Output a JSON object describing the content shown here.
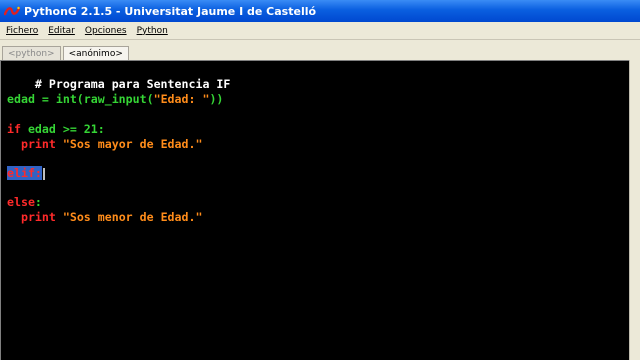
{
  "window": {
    "title": "PythonG 2.1.5 - Universitat Jaume I de Castelló"
  },
  "menu": {
    "items": [
      {
        "label": "Fichero"
      },
      {
        "label": "Editar"
      },
      {
        "label": "Opciones"
      },
      {
        "label": "Python"
      }
    ]
  },
  "tabs": [
    {
      "label": "<python>",
      "active": false
    },
    {
      "label": "<anónimo>",
      "active": true
    }
  ],
  "editor": {
    "lines": [
      {
        "comment": "# Programa para Sentencia IF"
      },
      {
        "var": "edad = int(raw_input(",
        "str": "\"Edad: \"",
        "close": "))"
      },
      {
        "kw": "if",
        "rest": " edad >= 21:"
      },
      {
        "indent": "  ",
        "kw": "print",
        "str": " \"Sos mayor de Edad.\""
      },
      {
        "selected": "elif:"
      },
      {
        "kw": "else",
        "rest": ":"
      },
      {
        "indent": "  ",
        "kw": "print",
        "str": " \"Sos menor de Edad.\""
      }
    ]
  },
  "colors": {
    "editor_bg": "#000000",
    "comment": "#ffffff",
    "default_text": "#35d535",
    "string": "#ff8c1a",
    "keyword": "#ff2a2a",
    "selection": "#3163c5"
  }
}
